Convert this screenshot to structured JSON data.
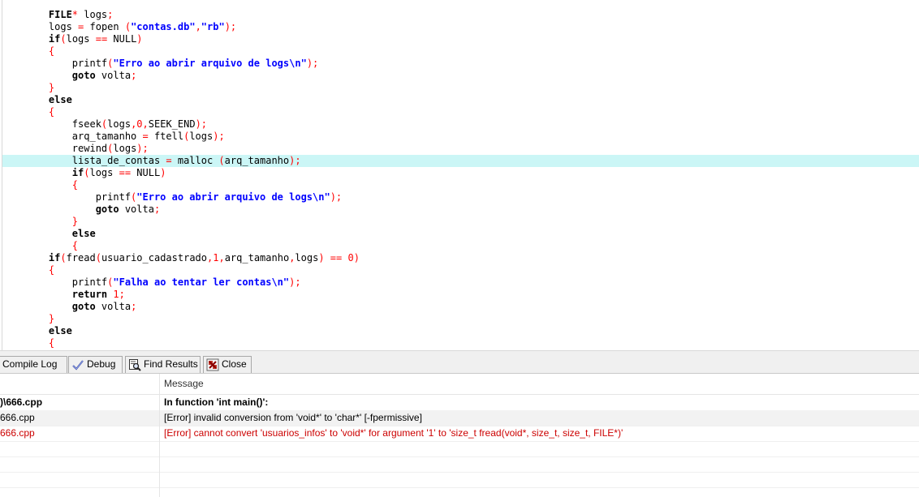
{
  "editor": {
    "lines": [
      [
        {
          "t": "    FILE",
          "c": "kw"
        },
        {
          "t": "* ",
          "c": "sym"
        },
        {
          "t": "logs",
          "c": "plain"
        },
        {
          "t": ";",
          "c": "sym"
        }
      ],
      [
        {
          "t": "    logs ",
          "c": "plain"
        },
        {
          "t": "=",
          "c": "sym"
        },
        {
          "t": " fopen ",
          "c": "plain"
        },
        {
          "t": "(",
          "c": "sym"
        },
        {
          "t": "\"contas.db\"",
          "c": "str"
        },
        {
          "t": ",",
          "c": "sym"
        },
        {
          "t": "\"rb\"",
          "c": "str"
        },
        {
          "t": ");",
          "c": "sym"
        }
      ],
      [
        {
          "t": "    if",
          "c": "kw"
        },
        {
          "t": "(",
          "c": "sym"
        },
        {
          "t": "logs ",
          "c": "plain"
        },
        {
          "t": "==",
          "c": "sym"
        },
        {
          "t": " NULL",
          "c": "plain"
        },
        {
          "t": ")",
          "c": "sym"
        }
      ],
      [
        {
          "t": "    {",
          "c": "sym"
        }
      ],
      [
        {
          "t": "        printf",
          "c": "plain"
        },
        {
          "t": "(",
          "c": "sym"
        },
        {
          "t": "\"Erro ao abrir arquivo de logs\\n\"",
          "c": "str"
        },
        {
          "t": ");",
          "c": "sym"
        }
      ],
      [
        {
          "t": "        goto",
          "c": "kw"
        },
        {
          "t": " volta",
          "c": "plain"
        },
        {
          "t": ";",
          "c": "sym"
        }
      ],
      [
        {
          "t": "    }",
          "c": "sym"
        }
      ],
      [
        {
          "t": "    else",
          "c": "kw"
        }
      ],
      [
        {
          "t": "    {",
          "c": "sym"
        }
      ],
      [
        {
          "t": "        fseek",
          "c": "plain"
        },
        {
          "t": "(",
          "c": "sym"
        },
        {
          "t": "logs",
          "c": "plain"
        },
        {
          "t": ",",
          "c": "sym"
        },
        {
          "t": "0",
          "c": "num"
        },
        {
          "t": ",",
          "c": "sym"
        },
        {
          "t": "SEEK_END",
          "c": "plain"
        },
        {
          "t": ");",
          "c": "sym"
        }
      ],
      [
        {
          "t": "        arq_tamanho ",
          "c": "plain"
        },
        {
          "t": "=",
          "c": "sym"
        },
        {
          "t": " ftell",
          "c": "plain"
        },
        {
          "t": "(",
          "c": "sym"
        },
        {
          "t": "logs",
          "c": "plain"
        },
        {
          "t": ");",
          "c": "sym"
        }
      ],
      [
        {
          "t": "        rewind",
          "c": "plain"
        },
        {
          "t": "(",
          "c": "sym"
        },
        {
          "t": "logs",
          "c": "plain"
        },
        {
          "t": ");",
          "c": "sym"
        }
      ],
      [
        {
          "t": "        lista_de_contas ",
          "c": "plain"
        },
        {
          "t": "=",
          "c": "sym"
        },
        {
          "t": " malloc ",
          "c": "plain"
        },
        {
          "t": "(",
          "c": "sym"
        },
        {
          "t": "arq_tamanho",
          "c": "plain"
        },
        {
          "t": ");",
          "c": "sym"
        }
      ],
      [
        {
          "t": "        if",
          "c": "kw"
        },
        {
          "t": "(",
          "c": "sym"
        },
        {
          "t": "logs ",
          "c": "plain"
        },
        {
          "t": "==",
          "c": "sym"
        },
        {
          "t": " NULL",
          "c": "plain"
        },
        {
          "t": ")",
          "c": "sym"
        }
      ],
      [
        {
          "t": "        {",
          "c": "sym"
        }
      ],
      [
        {
          "t": "            printf",
          "c": "plain"
        },
        {
          "t": "(",
          "c": "sym"
        },
        {
          "t": "\"Erro ao abrir arquivo de logs\\n\"",
          "c": "str"
        },
        {
          "t": ");",
          "c": "sym"
        }
      ],
      [
        {
          "t": "            goto",
          "c": "kw"
        },
        {
          "t": " volta",
          "c": "plain"
        },
        {
          "t": ";",
          "c": "sym"
        }
      ],
      [
        {
          "t": "        }",
          "c": "sym"
        }
      ],
      [
        {
          "t": "        else",
          "c": "kw"
        }
      ],
      [
        {
          "t": "        {",
          "c": "sym"
        }
      ],
      [
        {
          "t": "    if",
          "c": "kw"
        },
        {
          "t": "(",
          "c": "sym"
        },
        {
          "t": "fread",
          "c": "plain"
        },
        {
          "t": "(",
          "c": "sym"
        },
        {
          "t": "usuario_cadastrado",
          "c": "plain"
        },
        {
          "t": ",",
          "c": "sym"
        },
        {
          "t": "1",
          "c": "num"
        },
        {
          "t": ",",
          "c": "sym"
        },
        {
          "t": "arq_tamanho",
          "c": "plain"
        },
        {
          "t": ",",
          "c": "sym"
        },
        {
          "t": "logs",
          "c": "plain"
        },
        {
          "t": ") ",
          "c": "sym"
        },
        {
          "t": "==",
          "c": "sym"
        },
        {
          "t": " ",
          "c": "plain"
        },
        {
          "t": "0",
          "c": "num"
        },
        {
          "t": ")",
          "c": "sym"
        }
      ],
      [
        {
          "t": "    {",
          "c": "sym"
        }
      ],
      [
        {
          "t": "        printf",
          "c": "plain"
        },
        {
          "t": "(",
          "c": "sym"
        },
        {
          "t": "\"Falha ao tentar ler contas\\n\"",
          "c": "str"
        },
        {
          "t": ");",
          "c": "sym"
        }
      ],
      [
        {
          "t": "        return",
          "c": "kw"
        },
        {
          "t": " ",
          "c": "plain"
        },
        {
          "t": "1",
          "c": "num"
        },
        {
          "t": ";",
          "c": "sym"
        }
      ],
      [
        {
          "t": "        goto",
          "c": "kw"
        },
        {
          "t": " volta",
          "c": "plain"
        },
        {
          "t": ";",
          "c": "sym"
        }
      ],
      [
        {
          "t": "    }",
          "c": "sym"
        }
      ],
      [
        {
          "t": "    else",
          "c": "kw"
        }
      ],
      [
        {
          "t": "    {",
          "c": "sym"
        }
      ]
    ],
    "active_line_index": 12
  },
  "tabs": [
    {
      "label": "Compile Log",
      "icon": "compile-log-icon"
    },
    {
      "label": "Debug",
      "icon": "debug-check-icon"
    },
    {
      "label": "Find Results",
      "icon": "find-results-icon"
    },
    {
      "label": "Close",
      "icon": "close-icon"
    }
  ],
  "messages": {
    "header_message": "Message",
    "rows": [
      {
        "file": ")\\666.cpp",
        "message": "In function 'int main()':",
        "style": "bold"
      },
      {
        "file": "666.cpp",
        "message": "[Error] invalid conversion from 'void*' to 'char*' [-fpermissive]",
        "style": "plain"
      },
      {
        "file": "666.cpp",
        "message": "[Error] cannot convert 'usuarios_infos' to 'void*' for argument '1' to 'size_t fread(void*, size_t, size_t, FILE*)'",
        "style": "err"
      },
      {
        "file": "",
        "message": "",
        "style": "plain"
      },
      {
        "file": "",
        "message": "",
        "style": "plain"
      },
      {
        "file": "",
        "message": "",
        "style": "plain"
      }
    ]
  },
  "colors": {
    "active_line": "#cbf6f6",
    "string": "#0000ff",
    "symbol": "#ff0000",
    "error_text": "#cc0000"
  }
}
